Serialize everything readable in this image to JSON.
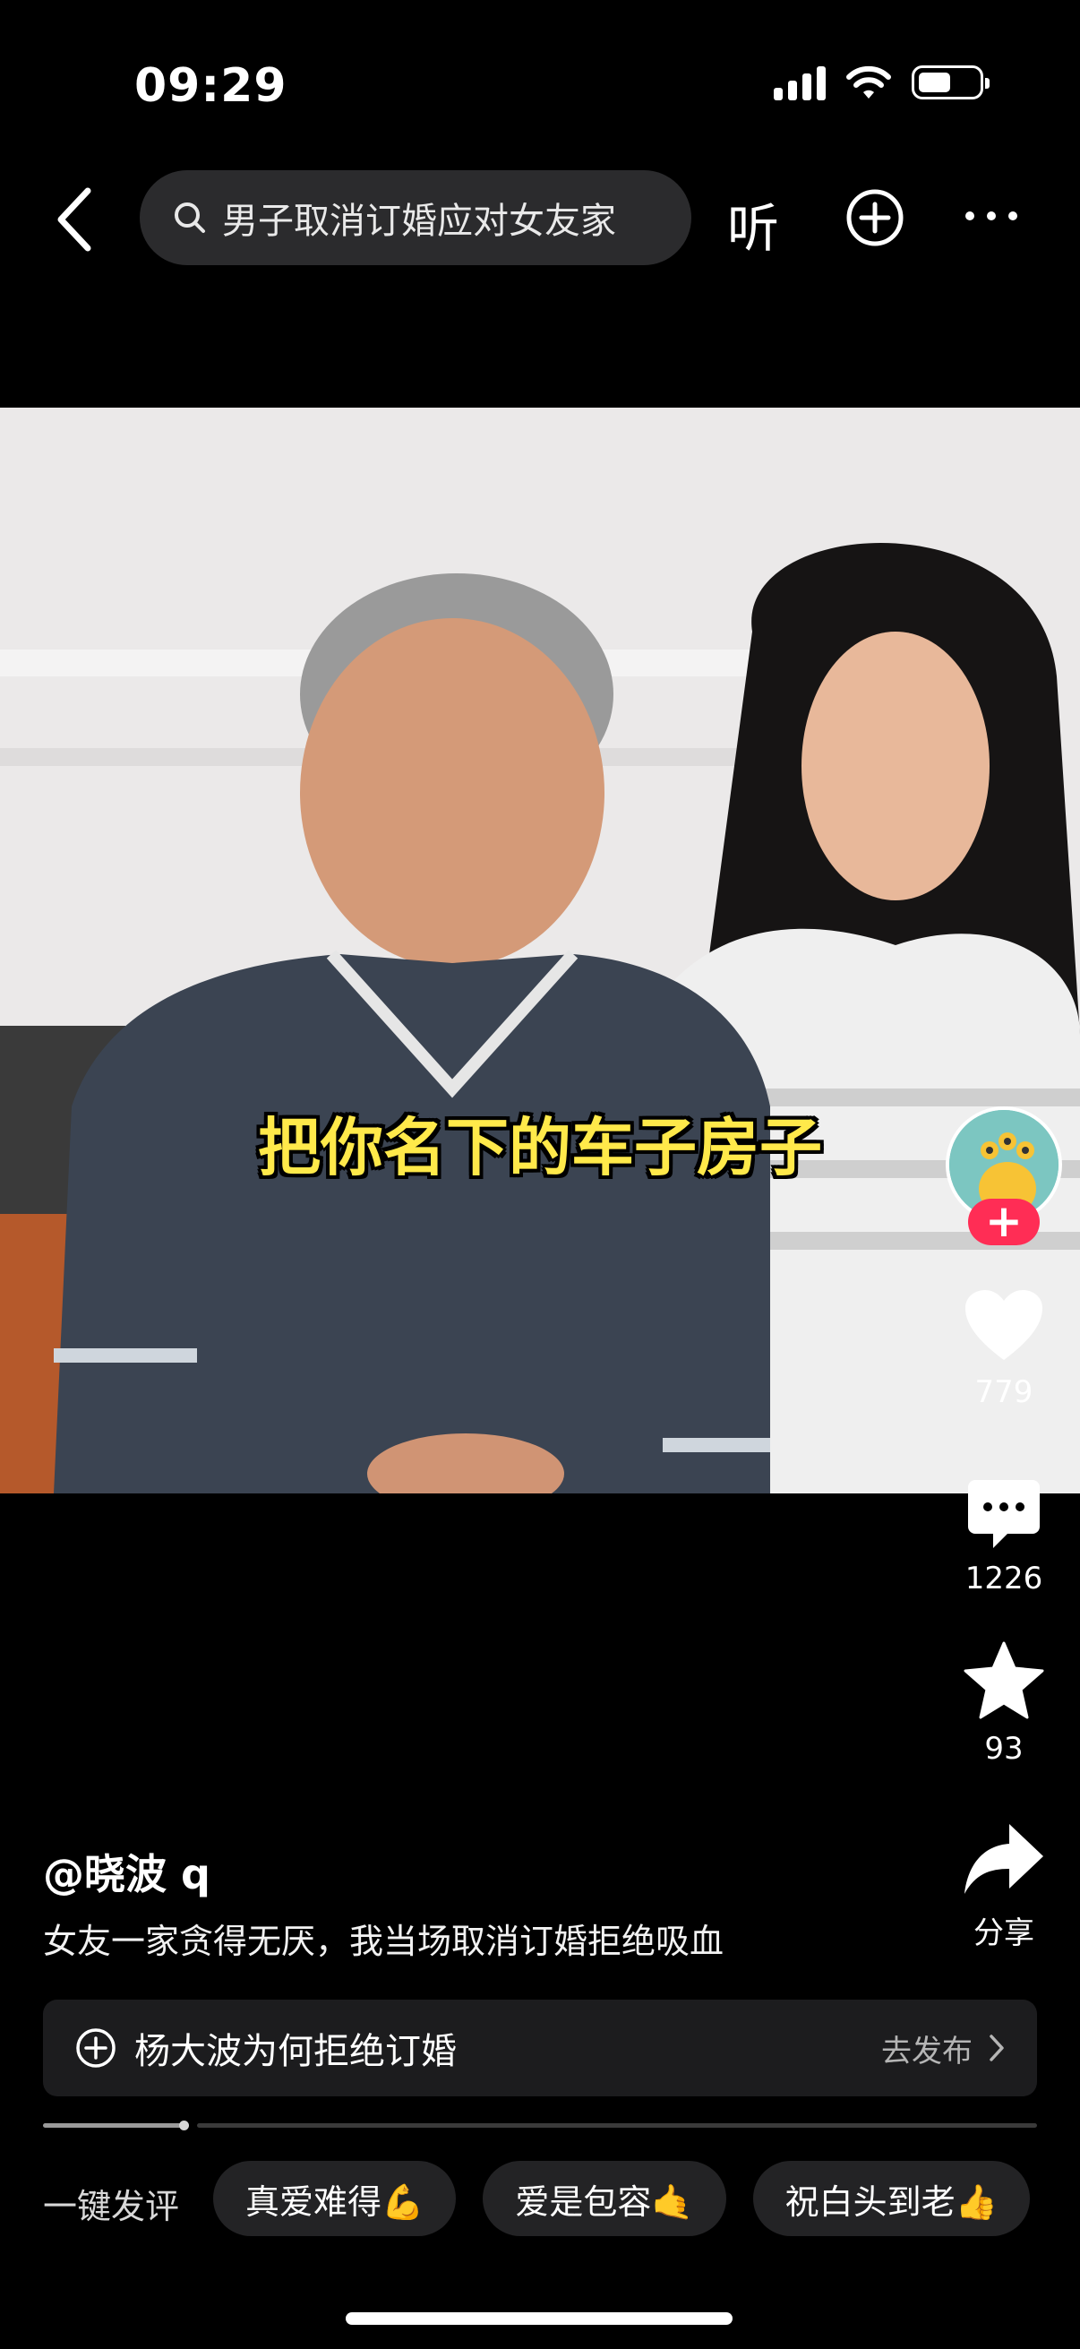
{
  "status_bar": {
    "time": "09:29",
    "battery_level": 0.55
  },
  "nav": {
    "search_query": "男子取消订婚应对女友家",
    "listen_label": "听"
  },
  "video": {
    "subtitle": "把你名下的车子房子"
  },
  "rail": {
    "follow_label": "+",
    "likes": "779",
    "comments": "1226",
    "favorites": "93",
    "share_label": "分享"
  },
  "post": {
    "author": "@晓波 q",
    "caption": "女友一家贪得无厌，我当场取消订婚拒绝吸血",
    "topic": "杨大波为何拒绝订婚",
    "publish_label": "去发布",
    "progress": 0.14
  },
  "quick_comments": {
    "label": "一键发评",
    "chips": [
      "真爱难得💪",
      "爱是包容🤙",
      "祝白头到老👍"
    ]
  }
}
